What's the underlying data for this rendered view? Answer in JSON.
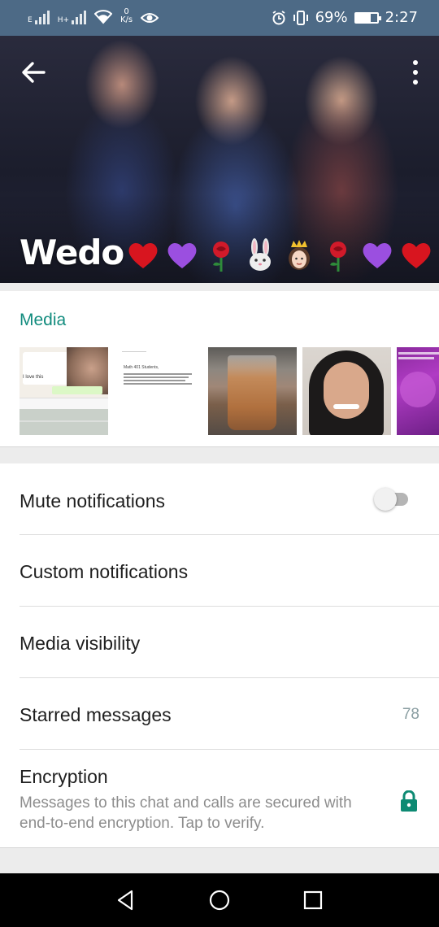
{
  "status_bar": {
    "network_1": "E",
    "network_2": "H+",
    "speed_value": "0",
    "speed_unit": "K/s",
    "battery": "69%",
    "time": "2:27"
  },
  "header": {
    "title": "Wedo",
    "emojis": [
      "red-heart",
      "purple-heart",
      "rose",
      "rabbit-face",
      "princess",
      "rose",
      "purple-heart",
      "red-heart"
    ]
  },
  "media": {
    "label": "Media",
    "thumbnails": [
      {
        "kind": "chat-screenshot",
        "caption": "I love this"
      },
      {
        "kind": "document-screenshot",
        "heading": "Math 401 Students,"
      },
      {
        "kind": "photo-drink"
      },
      {
        "kind": "photo-selfie"
      },
      {
        "kind": "photo-purple-post"
      }
    ]
  },
  "settings": {
    "mute": {
      "label": "Mute notifications",
      "enabled": false
    },
    "custom": {
      "label": "Custom notifications"
    },
    "visibility": {
      "label": "Media visibility"
    },
    "starred": {
      "label": "Starred messages",
      "count": "78"
    },
    "encryption": {
      "label": "Encryption",
      "description": "Messages to this chat and calls are secured with end-to-end encryption. Tap to verify."
    }
  },
  "colors": {
    "status_bar": "#4d6a86",
    "accent": "#128c7e",
    "lock_icon": "#0d8a73"
  }
}
